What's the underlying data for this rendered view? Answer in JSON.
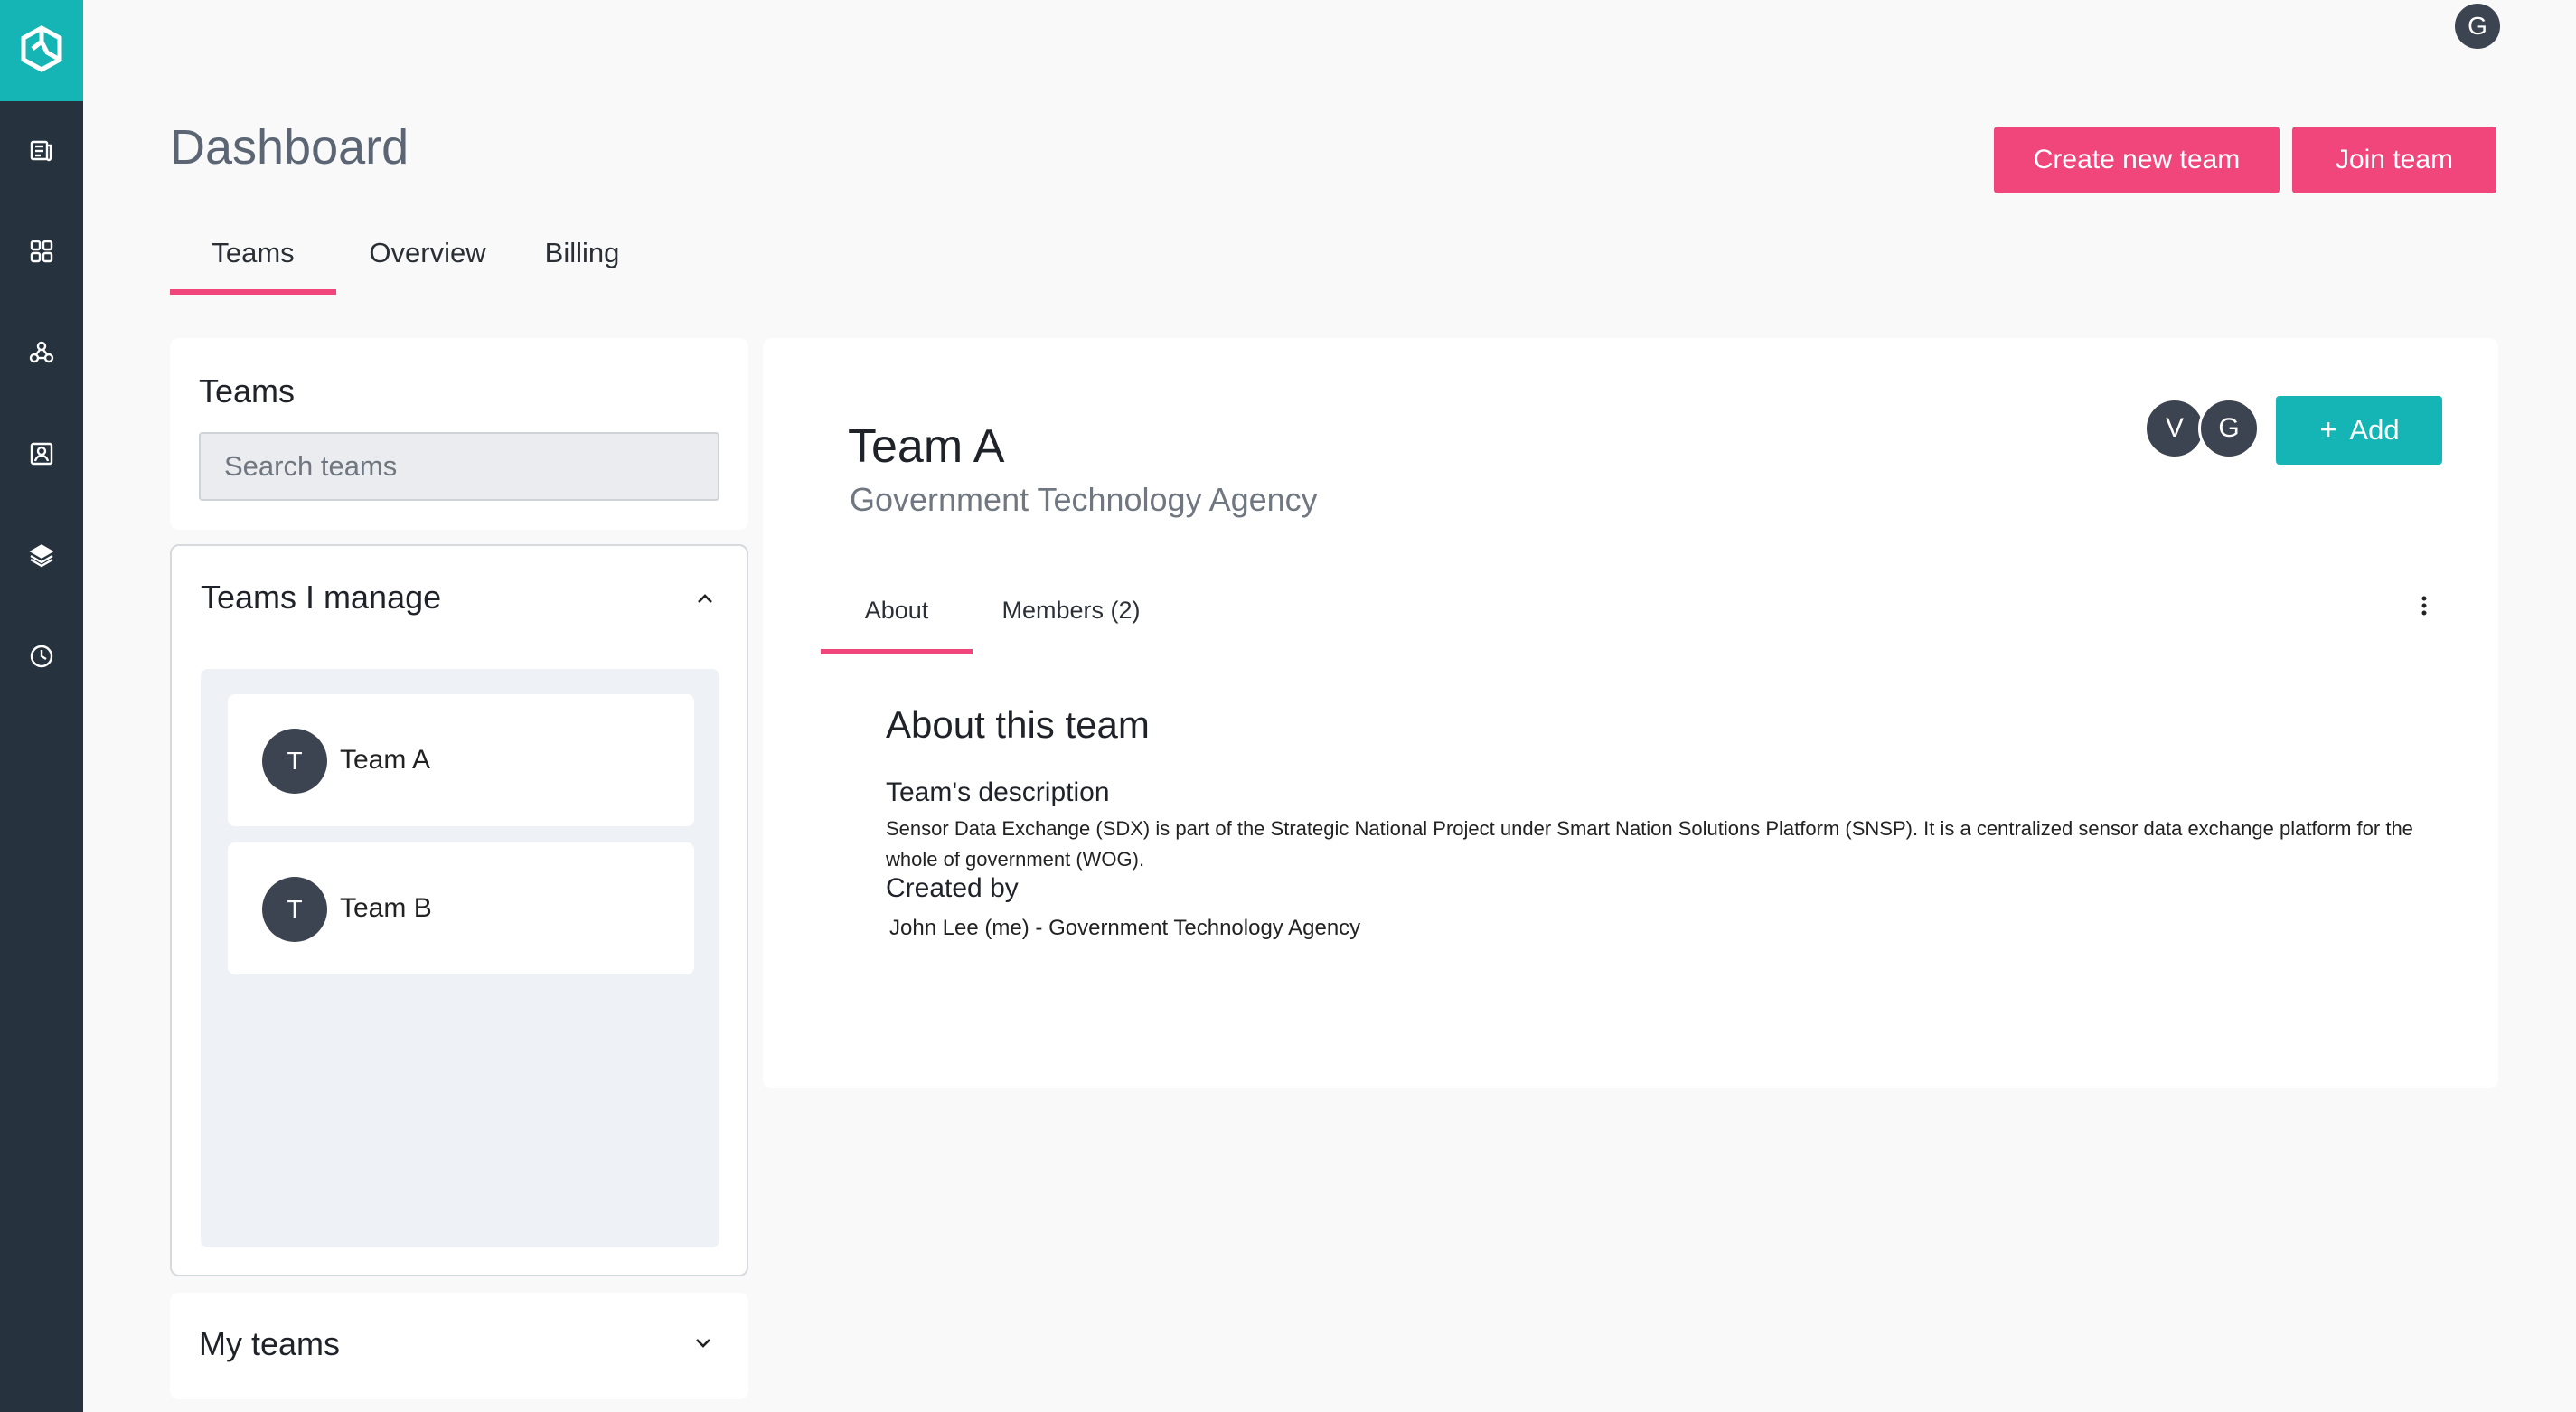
{
  "header": {
    "title": "Dashboard",
    "user_initial": "G",
    "create_team_label": "Create new team",
    "join_team_label": "Join team"
  },
  "tabs": [
    {
      "label": "Teams",
      "active": true
    },
    {
      "label": "Overview",
      "active": false
    },
    {
      "label": "Billing",
      "active": false
    }
  ],
  "sidebar": {
    "icons": [
      "logo-icon",
      "documents-icon",
      "apps-grid-icon",
      "network-icon",
      "contacts-icon",
      "layers-icon",
      "clock-icon"
    ]
  },
  "search": {
    "heading": "Teams",
    "placeholder": "Search teams"
  },
  "teams_manage": {
    "heading": "Teams I manage",
    "items": [
      {
        "initial": "T",
        "name": "Team A"
      },
      {
        "initial": "T",
        "name": "Team B"
      }
    ]
  },
  "my_teams": {
    "heading": "My teams"
  },
  "team_detail": {
    "name": "Team A",
    "organization": "Government Technology Agency",
    "members": [
      "V",
      "G"
    ],
    "add_label": "Add",
    "subtabs": [
      {
        "label": "About",
        "active": true
      },
      {
        "label": "Members (2)",
        "active": false
      }
    ],
    "about_title": "About this team",
    "description_label": "Team's description",
    "description_text": "Sensor   Data Exchange (SDX) is part of the Strategic National Project under Smart Nation Solutions Platform (SNSP). It is a centralized sensor data exchange platform for the whole of government (WOG).",
    "created_by_label": "Created by",
    "created_by_text": "John Lee (me) - Government Technology Agency"
  },
  "colors": {
    "accent_pink": "#f0467c",
    "accent_teal": "#14b5b4",
    "sidebar_bg": "#26333f"
  }
}
